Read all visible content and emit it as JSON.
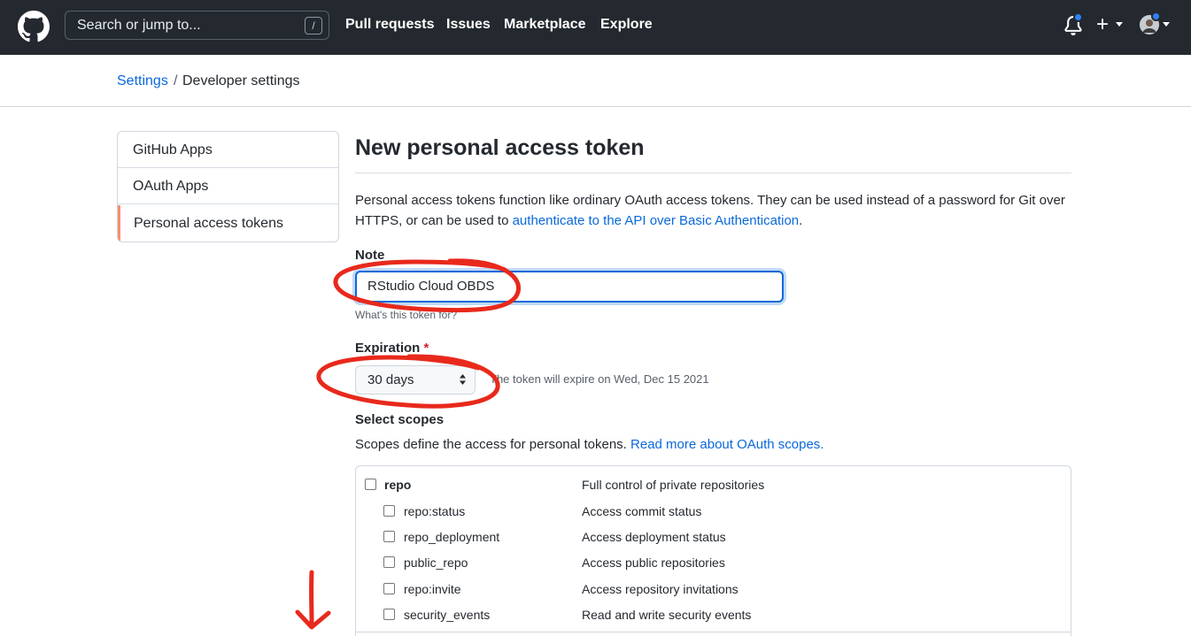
{
  "header": {
    "search_placeholder": "Search or jump to...",
    "search_shortcut": "/",
    "nav": [
      "Pull requests",
      "Issues",
      "Marketplace",
      "Explore"
    ],
    "new_label": "+"
  },
  "breadcrumb": {
    "root": "Settings",
    "separator": "/",
    "current": "Developer settings"
  },
  "sidebar": {
    "items": [
      {
        "label": "GitHub Apps"
      },
      {
        "label": "OAuth Apps"
      },
      {
        "label": "Personal access tokens"
      }
    ],
    "active_index": 2
  },
  "main": {
    "title": "New personal access token",
    "intro_text": "Personal access tokens function like ordinary OAuth access tokens. They can be used instead of a password for Git over HTTPS, or can be used to ",
    "intro_link": "authenticate to the API over Basic Authentication",
    "intro_end": ".",
    "note_label": "Note",
    "note_value": "RStudio Cloud OBDS",
    "note_hint": "What's this token for?",
    "expiration_label": "Expiration",
    "required_mark": "*",
    "expiration_value": "30 days",
    "expiration_text": "The token will expire on Wed, Dec 15 2021",
    "scopes_label": "Select scopes",
    "scopes_text": "Scopes define the access for personal tokens. ",
    "scopes_link": "Read more about OAuth scopes."
  },
  "scopes": {
    "parent": {
      "name": "repo",
      "description": "Full control of private repositories"
    },
    "children": [
      {
        "name": "repo:status",
        "description": "Access commit status"
      },
      {
        "name": "repo_deployment",
        "description": "Access deployment status"
      },
      {
        "name": "public_repo",
        "description": "Access public repositories"
      },
      {
        "name": "repo:invite",
        "description": "Access repository invitations"
      },
      {
        "name": "security_events",
        "description": "Read and write security events"
      }
    ]
  },
  "colors": {
    "header_bg": "#24292f",
    "link": "#0969da",
    "annotation": "#e8291c",
    "active_marker": "#fd8c73",
    "notification_dot": "#2f81f7"
  }
}
